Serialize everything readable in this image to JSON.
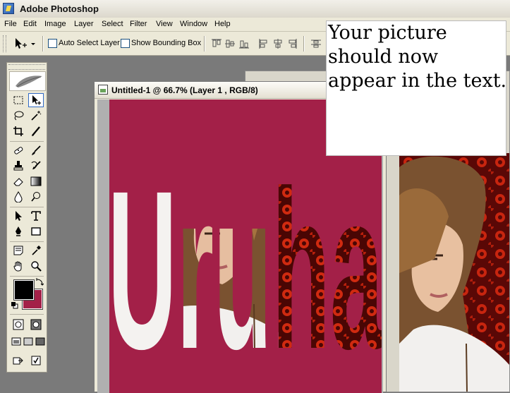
{
  "app": {
    "title": "Adobe Photoshop"
  },
  "menu": [
    "File",
    "Edit",
    "Image",
    "Layer",
    "Select",
    "Filter",
    "View",
    "Window",
    "Help"
  ],
  "options": {
    "auto_select_label": "Auto Select Layer",
    "auto_select_checked": false,
    "bounding_box_label": "Show Bounding Box",
    "bounding_box_checked": false
  },
  "document": {
    "title": "Untitled-1 @ 66.7% (Layer 1 , RGB/8)",
    "canvas_text": "Uruha",
    "canvas_color": "#a32048"
  },
  "colors": {
    "foreground": "#000000",
    "background": "#a32048"
  },
  "note": {
    "text": "Your picture should now appear in the text."
  },
  "tools": [
    "rectangular-marquee-icon",
    "move-icon",
    "lasso-icon",
    "magic-wand-icon",
    "crop-icon",
    "slice-icon",
    "healing-brush-icon",
    "brush-icon",
    "clone-stamp-icon",
    "history-brush-icon",
    "eraser-icon",
    "gradient-icon",
    "blur-icon",
    "dodge-icon",
    "path-selection-icon",
    "type-icon",
    "pen-icon",
    "rectangle-shape-icon",
    "notes-icon",
    "eyedropper-icon",
    "hand-icon",
    "zoom-icon"
  ]
}
